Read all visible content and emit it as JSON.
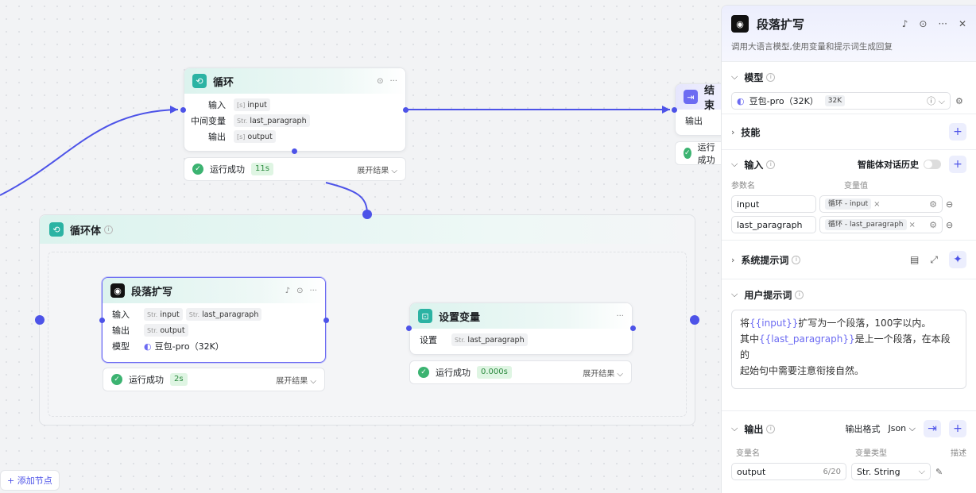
{
  "canvas": {
    "add_node": "+ 添加节点",
    "loop_node": {
      "title": "循环",
      "rows": [
        {
          "label": "输入",
          "tags": [
            {
              "type": "[s]",
              "name": "input"
            }
          ]
        },
        {
          "label": "中间变量",
          "tags": [
            {
              "type": "Str.",
              "name": "last_paragraph"
            }
          ]
        },
        {
          "label": "输出",
          "tags": [
            {
              "type": "[s]",
              "name": "output"
            }
          ]
        }
      ],
      "status": "运行成功",
      "duration": "11s",
      "expand": "展开结果 ⌵"
    },
    "end_node": {
      "title": "结束",
      "row_label": "输出",
      "status": "运行成功"
    },
    "loop_body": {
      "title": "循环体"
    },
    "para_node": {
      "title": "段落扩写",
      "rows": [
        {
          "label": "输入",
          "tags": [
            {
              "type": "Str.",
              "name": "input"
            },
            {
              "type": "Str.",
              "name": "last_paragraph"
            }
          ]
        },
        {
          "label": "输出",
          "tags": [
            {
              "type": "Str.",
              "name": "output"
            }
          ]
        }
      ],
      "model_label": "模型",
      "model_value": "豆包-pro（32K）",
      "status": "运行成功",
      "duration": "2s",
      "expand": "展开结果 ⌵"
    },
    "setvar_node": {
      "title": "设置变量",
      "row_label": "设置",
      "tag_type": "Str.",
      "tag_name": "last_paragraph",
      "status": "运行成功",
      "duration": "0.000s",
      "expand": "展开结果 ⌵"
    }
  },
  "panel": {
    "title": "段落扩写",
    "description": "调用大语言模型,使用变量和提示词生成回复",
    "model": {
      "label": "模型",
      "value": "豆包-pro（32K）",
      "badge": "32K"
    },
    "skills": {
      "label": "技能"
    },
    "input": {
      "label": "输入",
      "history": "智能体对话历史",
      "col_name": "参数名",
      "col_value": "变量值",
      "rows": [
        {
          "name": "input",
          "value": "循环 - input"
        },
        {
          "name": "last_paragraph",
          "value": "循环 - last_paragraph"
        }
      ]
    },
    "system_prompt": {
      "label": "系统提示词"
    },
    "user_prompt": {
      "label": "用户提示词",
      "l1a": "将",
      "l1v": "{{input}}",
      "l1b": "扩写为一个段落，100字以内。",
      "l2a": "其中",
      "l2v": "{{last_paragraph}}",
      "l2b": "是上一个段落，在本段的",
      "l3": "起始句中需要注意衔接自然。"
    },
    "output": {
      "label": "输出",
      "format_label": "输出格式",
      "format_value": "Json",
      "col_name": "变量名",
      "col_type": "变量类型",
      "col_desc": "描述",
      "rows": [
        {
          "name": "output",
          "count": "6/20",
          "type": "Str. String"
        }
      ]
    }
  },
  "colors": {
    "accent": "#4d53e8",
    "teal": "#2bb3a3",
    "success": "#3cb371"
  }
}
